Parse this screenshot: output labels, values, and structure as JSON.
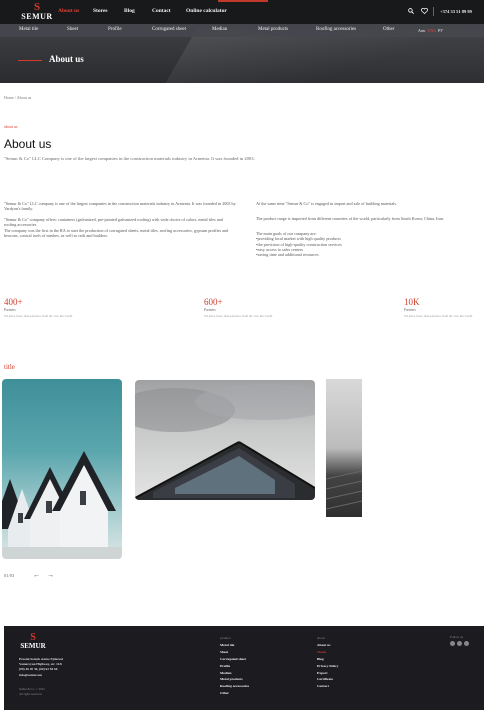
{
  "header": {
    "logo_mark": "S",
    "logo_word": "SEMUR",
    "nav": [
      "About us",
      "Stores",
      "Blog",
      "Contact",
      "Online calculator"
    ],
    "phone": "+374 33 51 89 99"
  },
  "categories": [
    "Metal tile",
    "Sheet",
    "Profile",
    "Corrugated sheet",
    "Median",
    "Metal products",
    "Roofing accessories",
    "Other"
  ],
  "languages": [
    "Arm",
    "ENG",
    "РУ"
  ],
  "hero": {
    "title": "About us"
  },
  "breadcrumb": {
    "home": "Home",
    "sep": "/",
    "current": "About us"
  },
  "about": {
    "eyebrow": "about us",
    "title": "About us",
    "lead": "\"Semur & Co\" LLC Company is one of the largest companies in the construction materials industry in Armenia. It was founded in 2003.",
    "left": [
      "\"Semur & Co\" LLC company is one of the largest companies in the construction materials industry in Armenia. It was founded in 2003 by Vardyan's family.",
      "\"Semur & Co\" company offers: containers (galvanized, pre-painted galvanized roofing) with wide choice of colors, metal tiles and roofing accessories.",
      "The company was the first in the RA to start the production of corrugated sheets, metal tiles, roofing accessories, gypsum profiles and beacons, conical tools of meshes, as well as rails and builders."
    ],
    "right_intro": "At the same time \"Semur & Co\" is engaged in import and sale of building materials.",
    "right_import": "The product range is imported from different countries of the world, particularly from South Korea, China, Iran.",
    "goals_title": "The main goals of our company are:",
    "goals": [
      "•providing local market with high quality products",
      "•the provision of high-quality construction services",
      "•easy access to sales centers",
      "•saving time and additional resources"
    ]
  },
  "stats": [
    {
      "num": "400+",
      "label": "Partners",
      "desc": "We have more than partners from all over the world"
    },
    {
      "num": "600+",
      "label": "Partners",
      "desc": "We have more than partners from all over the world"
    },
    {
      "num": "10K",
      "label": "Partners",
      "desc": "We have more than partners from all over the world"
    }
  ],
  "gallery": {
    "title": "title",
    "page": "01/03",
    "prev_icon": "←",
    "next_icon": "→"
  },
  "footer": {
    "logo_mark": "S",
    "logo_word": "SEMUR",
    "address": [
      "Proemi Semyk statue Ejdarosl",
      "Vamesvyan Highway, str. 11/b",
      "(00) 46 20 36, (60) 62 50 60",
      "info@semur.am"
    ],
    "copyright": [
      "Semur & Co, © 2022",
      "All rights reserved."
    ],
    "products_head": "product",
    "products": [
      "Metal tile",
      "Sheet",
      "Corrugated sheet",
      "Profile",
      "Median",
      "Metal products",
      "Roofing accessories",
      "Other"
    ],
    "about_head": "about",
    "about_links": [
      "About us",
      "Stores",
      "Blog",
      "Privacy Policy",
      "Export",
      "Certificate",
      "Contact"
    ],
    "follow": "Follow us"
  },
  "colors": {
    "accent": "#d23b2b",
    "dark": "#1c1c20"
  }
}
